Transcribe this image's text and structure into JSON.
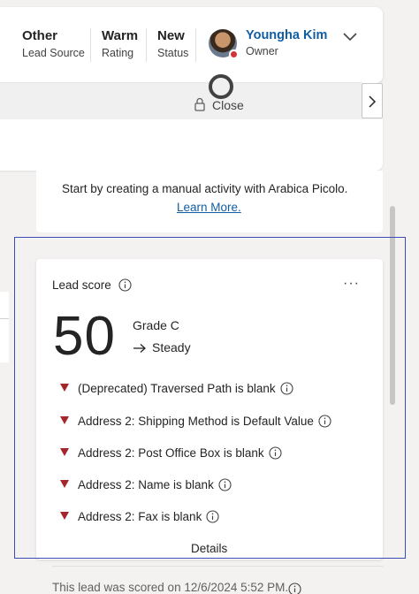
{
  "header": {
    "fields": [
      {
        "value": "Other",
        "label": "Lead Source"
      },
      {
        "value": "Warm",
        "label": "Rating"
      },
      {
        "value": "New",
        "label": "Status"
      }
    ],
    "owner": {
      "name": "Youngha Kim",
      "label": "Owner"
    }
  },
  "process": {
    "stage_label": "Close"
  },
  "timeline": {
    "message": "Start by creating a manual activity with Arabica Picolo.",
    "link": "Learn More."
  },
  "lead_score": {
    "title": "Lead score",
    "more": "···",
    "score": "50",
    "grade": "Grade C",
    "trend": "Steady",
    "reasons": [
      "(Deprecated) Traversed Path is blank",
      "Address 2: Shipping Method is Default Value",
      "Address 2: Post Office Box is blank",
      "Address 2: Name is blank",
      "Address 2: Fax is blank"
    ],
    "details": "Details",
    "footer": "This lead was scored on 12/6/2024 5:52 PM."
  },
  "colors": {
    "accent": "#115ea3",
    "negative": "#a4262c",
    "highlight": "#3b4bb8"
  }
}
